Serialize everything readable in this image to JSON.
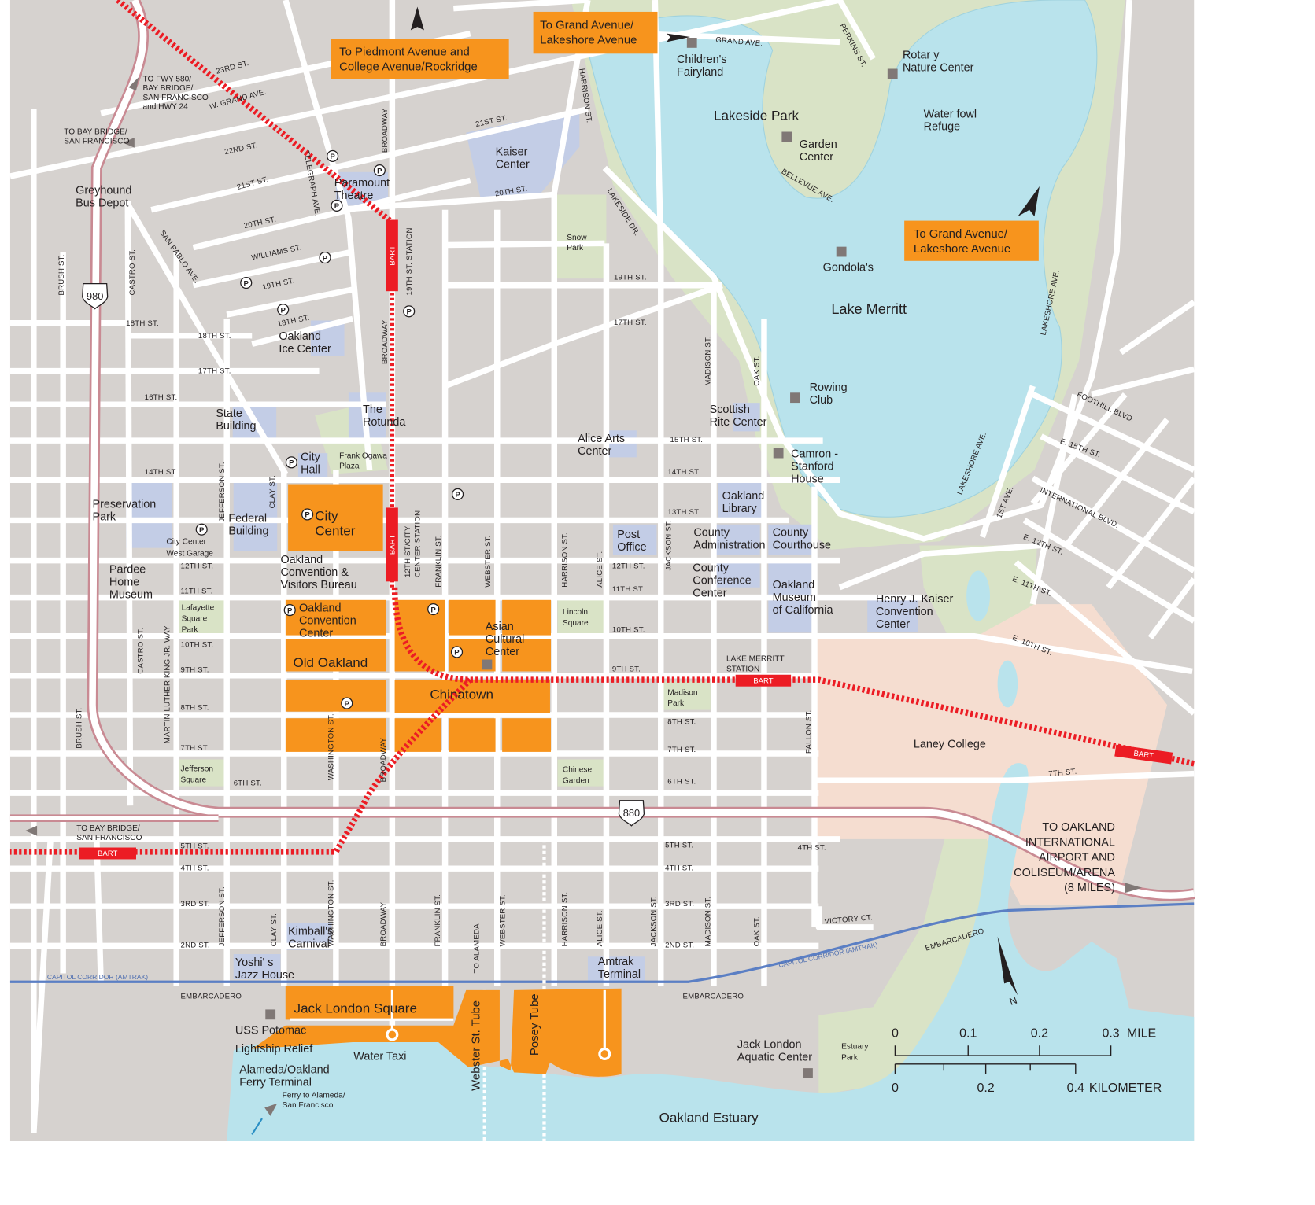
{
  "colors": {
    "land": "#d6d2cf",
    "water": "#b9e3ec",
    "park": "#d9e3c6",
    "building": "#c3cde6",
    "district": "#f7941d",
    "campus": "#f5ddd0",
    "bart": "#ec1c24",
    "freeway_edge": "#c98a93",
    "amtrak": "#5b7fc4",
    "street": "#ffffff"
  },
  "callouts": {
    "piedmont": [
      "To Piedmont Avenue and",
      "College Avenue/Rockridge"
    ],
    "grand_top": [
      "To Grand Avenue/",
      "Lakeshore Avenue"
    ],
    "grand_right": [
      "To Grand Avenue/",
      "Lakeshore Avenue"
    ]
  },
  "places": {
    "childrens_fairyland": [
      "Children's",
      "Fairyland"
    ],
    "rotary_nature_center": [
      "Rotar y",
      "Nature Center"
    ],
    "lakeside_park": [
      "Lakeside Park"
    ],
    "waterfowl_refuge": [
      "Water fowl",
      "Refuge"
    ],
    "garden_center": [
      "Garden",
      "Center"
    ],
    "kaiser_center": [
      "Kaiser",
      "Center"
    ],
    "greyhound": [
      "Greyhound",
      "Bus Depot"
    ],
    "paramount": [
      "Paramount",
      "Theatre"
    ],
    "snow_park": [
      "Snow",
      "Park"
    ],
    "gondolas": [
      "Gondola's"
    ],
    "lake_merritt": [
      "Lake Merritt"
    ],
    "oakland_ice_center": [
      "Oakland",
      "Ice Center"
    ],
    "rowing_club": [
      "Rowing",
      "Club"
    ],
    "rotunda": [
      "The",
      "Rotunda"
    ],
    "state_building": [
      "State",
      "Building"
    ],
    "scottish_rite": [
      "Scottish",
      "Rite Center"
    ],
    "alice_arts": [
      "Alice Arts",
      "Center"
    ],
    "city_hall": [
      "City",
      "Hall"
    ],
    "frank_ogawa": [
      "Frank Ogawa",
      "Plaza"
    ],
    "camron_stanford": [
      "Camron -",
      "Stanford",
      "House"
    ],
    "oakland_library": [
      "Oakland",
      "Library"
    ],
    "preservation_park": [
      "Preservation",
      "Park"
    ],
    "city_center": [
      "City",
      "Center"
    ],
    "federal_building": [
      "Federal",
      "Building"
    ],
    "city_center_garage": [
      "City Center",
      "West Garage"
    ],
    "post_office": [
      "Post",
      "Office"
    ],
    "county_administration": [
      "County",
      "Administration"
    ],
    "county_courthouse": [
      "County",
      "Courthouse"
    ],
    "visitors_bureau": [
      "Oakland",
      "Convention &",
      "Visitors Bureau"
    ],
    "pardee_home": [
      "Pardee",
      "Home",
      "Museum"
    ],
    "county_conference": [
      "County",
      "Conference",
      "Center"
    ],
    "oakland_museum": [
      "Oakland",
      "Museum",
      "of California"
    ],
    "henry_kaiser": [
      "Henry J. Kaiser",
      "Convention",
      "Center"
    ],
    "lafayette_square": [
      "Lafayette",
      "Square",
      "Park"
    ],
    "convention_center": [
      "Oakland",
      "Convention",
      "Center"
    ],
    "lincoln_square": [
      "Lincoln",
      "Square"
    ],
    "asian_cultural": [
      "Asian",
      "Cultural",
      "Center"
    ],
    "old_oakland": [
      "Old Oakland"
    ],
    "lake_merritt_station": [
      "LAKE MERRITT",
      "STATION"
    ],
    "chinatown": [
      "Chinatown"
    ],
    "madison_park": [
      "Madison",
      "Park"
    ],
    "laney_college": [
      "Laney College"
    ],
    "jefferson_square": [
      "Jefferson",
      "Square"
    ],
    "chinese_garden": [
      "Chinese",
      "Garden"
    ],
    "to_airport": [
      "TO OAKLAND",
      "INTERNATIONAL",
      "AIRPORT AND",
      "COLISEUM/ARENA",
      "(8 MILES)"
    ],
    "kimballs": [
      "Kimball's",
      "Carnival"
    ],
    "yoshis": [
      "Yoshi' s",
      "Jazz House"
    ],
    "amtrak_terminal": [
      "Amtrak",
      "Terminal"
    ],
    "jack_london_square": [
      "Jack London Square"
    ],
    "uss_potomac": [
      "USS Potomac",
      "Lightship Relief"
    ],
    "water_taxi": [
      "Water Taxi"
    ],
    "ferry_terminal": [
      "Alameda/Oakland",
      "Ferry Terminal"
    ],
    "ferry_to": [
      "Ferry to Alameda/",
      "San Francisco"
    ],
    "webster_tube": [
      "Webster St. Tube"
    ],
    "posey_tube": [
      "Posey Tube"
    ],
    "aquatic_center": [
      "Jack London",
      "Aquatic Center"
    ],
    "estuary_park": [
      "Estuary",
      "Park"
    ],
    "oakland_estuary": [
      "Oakland Estuary"
    ],
    "to_fwy_580": [
      "TO FWY 580/",
      "BAY BRIDGE/",
      "SAN FRANCISCO",
      "and HWY 24"
    ],
    "to_bay_bridge_top": [
      "TO BAY BRIDGE/",
      "SAN FRANCISCO"
    ],
    "to_bay_bridge_bottom": [
      "TO BAY BRIDGE/",
      "SAN FRANCISCO"
    ]
  },
  "streets": {
    "s23rd": "23RD  ST.",
    "w_grand": "W. GRAND  AVE.",
    "s22nd": "22ND  ST.",
    "s21st_w": "21ST  ST.",
    "s20th_w": "20TH  ST.",
    "williams": "WILLIAMS  ST.",
    "s19th_w": "19TH  ST.",
    "s18th_diag": "18TH  ST.",
    "s18th_left": "18TH ST.",
    "s18th_mid": "18TH      ST.",
    "s17th_w": "17TH      ST.",
    "s16th": "16TH      ST.",
    "s14th_w": "14TH      ST.",
    "s12th_w": "12TH      ST.",
    "s11th_w": "11TH      ST.",
    "s10th_w": "10TH      ST.",
    "s9th_w": "9TH      ST.",
    "s8th_w": "8TH      ST.",
    "s7th_w": "7TH      ST.",
    "s6th_w": "6TH    ST.",
    "s5th_w": "5TH           ST.",
    "s4th_w": "4TH      ST.",
    "s3rd_w": "3RD      ST.",
    "s2nd_w": "2ND  ST.",
    "embarcadero_w": "EMBARCADERO",
    "s21st_e": "21ST  ST.",
    "s20th_e": "20TH  ST.",
    "grand_ave": "GRAND  AVE.",
    "perkins": "PERKINS  ST.",
    "bellevue": "BELLEVUE  AVE.",
    "s19th_e": "19TH  ST.",
    "s17th_e": "17TH  ST.",
    "s15th_e": "15TH ST.",
    "s14th_e": "14TH    ST.",
    "s13th_e": "13TH    ST.",
    "s12th_e": "12TH    ST.",
    "s11th_e": "11TH    ST.",
    "s10th_e": "10TH    ST.",
    "s9th_e": "9TH    ST.",
    "s8th_e": "8TH    ST.",
    "s7th_e": "7TH    ST.",
    "s6th_e": "6TH    ST.",
    "s5th_e": "5TH         ST.",
    "s4th_e": "4TH         ST.",
    "s3rd_e": "3RD         ST.",
    "s2nd_e": "2ND         ST.",
    "s4th_far": "4TH ST.",
    "victory": "VICTORY CT.",
    "embarcadero_e": "EMBARCADERO",
    "embarcadero_far": "EMBARCADERO",
    "s7th_far": "7TH  ST.",
    "e10th": "E. 10TH  ST.",
    "e11th": "E. 11TH     ST.",
    "e12th": "E. 12TH        ST.",
    "e15th": "E. 15TH         ST.",
    "international": "INTERNATIONAL  BLVD.",
    "foothill": "FOOTHILL  BLVD.",
    "first_ave": "1ST  AVE.",
    "lakeshore_s": "LAKESHORE  AVE.",
    "lakeshore_e": "LAKESHORE  AVE.",
    "lakeside_dr": "LAKESIDE  DR.",
    "harrison_n": "HARRISON  ST.",
    "broadway_n": "BROADWAY",
    "broadway_mid": "BROADWAY",
    "station_19th": "19TH ST. STATION",
    "telegraph": "TELEGRAPH  AVE.",
    "san_pablo": "SAN PABLO  AVE.",
    "brush_n": "BRUSH      ST.",
    "castro_n": "CASTRO      ST.",
    "jefferson_mid": "JEFFERSON  ST.",
    "clay_mid": "CLAY    ST.",
    "station_12th_a": "12TH ST/CITY",
    "station_12th_b": "CENTER STATION",
    "franklin_mid": "FRANKLIN      ST.",
    "webster_mid": "WEBSTER        ST.",
    "harrison_mid": "HARRISON  ST.",
    "alice_mid": "ALICE        ST.",
    "jackson_mid": "JACKSON        ST.",
    "madison_mid": "MADISON   ST.",
    "oak_mid": "OAK   ST.",
    "castro_s": "CASTRO ST.",
    "mlk": "MARTIN LUTHER KING JR. WAY",
    "brush_s": "BRUSH  ST.",
    "washington_mid": "WASHINGTON     ST.",
    "broadway_s": "BROADWAY",
    "fallon": "FALLON      ST.",
    "jefferson_s": "JEFFERSON  ST.",
    "clay_s": "CLAY     ST.",
    "washington_s": "WASHINGTON  ST.",
    "broadway_b": "BROADWAY",
    "franklin_s": "FRANKLIN     ST.",
    "to_alameda": "TO ALAMEDA",
    "webster_s": "WEBSTER     ST.",
    "harrison_s": "HARRISON     ST.",
    "alice_s": "ALICE     ST.",
    "jackson_s": "JACKSON     ST.",
    "madison_s": "MADISON     ST.",
    "oak_s": "OAK     ST."
  },
  "rail": {
    "capitol_corridor_w": "CAPITOL    CORRIDOR (AMTRAK)",
    "capitol_corridor_e": "CAPITOL    CORRIDOR (AMTRAK)",
    "bart_label": "BART"
  },
  "shields": {
    "i980": "980",
    "i880": "880"
  },
  "parking_symbol": "P",
  "scale": {
    "mile_ticks": [
      "0",
      "0.1",
      "0.2",
      "0.3"
    ],
    "mile_unit": "MILE",
    "km_ticks": [
      "0",
      "0.2",
      "0.4"
    ],
    "km_unit": "KILOMETER"
  },
  "north": "N"
}
